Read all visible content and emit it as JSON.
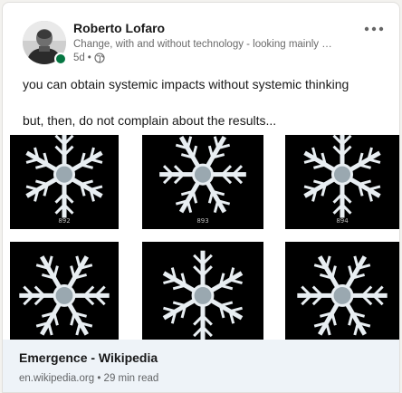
{
  "post": {
    "author": {
      "name": "Roberto Lofaro",
      "headline": "Change, with and without technology - looking mainly …",
      "age": "5d",
      "separator": "•",
      "visibility_icon": "globe-icon",
      "online": true
    },
    "menu_icon": "more-horizontal-icon",
    "text": {
      "line1": "you can obtain systemic impacts without systemic thinking",
      "line2": "but, then, do not complain about the results..."
    },
    "media": {
      "image_subject": "snowflake-photographs",
      "plate_numbers": [
        "892",
        "893",
        "894"
      ]
    },
    "link": {
      "title": "Emergence - Wikipedia",
      "domain": "en.wikipedia.org",
      "separator": "•",
      "read_time": "29 min read"
    }
  },
  "colors": {
    "presence": "#057642",
    "link_bar": "#eef3f8",
    "card": "#ffffff",
    "page": "#f3f2ef"
  }
}
